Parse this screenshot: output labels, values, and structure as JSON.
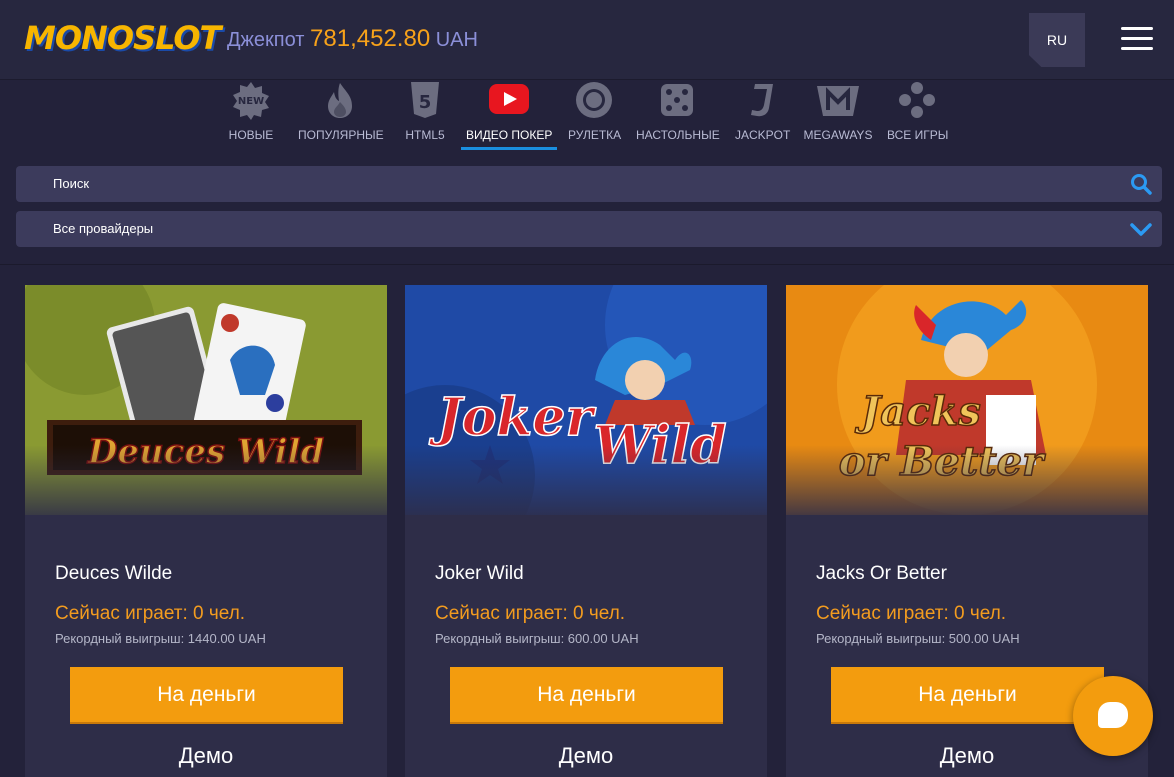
{
  "header": {
    "logo_text": "MONOSLOT",
    "jackpot_label": "Джекпот",
    "jackpot_amount": "781,452.80",
    "jackpot_currency": "UAH",
    "lang": "RU"
  },
  "categories": [
    {
      "label": "НОВЫЕ",
      "icon": "new-badge-icon"
    },
    {
      "label": "ПОПУЛЯРНЫЕ",
      "icon": "fire-icon"
    },
    {
      "label": "HTML5",
      "icon": "html5-icon"
    },
    {
      "label": "ВИДЕО ПОКЕР",
      "icon": "video-play-icon",
      "active": true
    },
    {
      "label": "РУЛЕТКА",
      "icon": "roulette-icon"
    },
    {
      "label": "НАСТОЛЬНЫЕ",
      "icon": "dice-icon"
    },
    {
      "label": "JACKPOT",
      "icon": "jackpot-icon"
    },
    {
      "label": "MEGAWAYS",
      "icon": "megaways-icon"
    },
    {
      "label": "ВСЕ ИГРЫ",
      "icon": "all-games-icon"
    }
  ],
  "search": {
    "placeholder": "Поиск"
  },
  "providers": {
    "selected": "Все провайдеры"
  },
  "games": [
    {
      "title": "Deuces Wilde",
      "players": "Сейчас играет: 0 чел.",
      "record": "Рекордный выигрыш: 1440.00 UAH",
      "money": "На деньги",
      "demo": "Демо",
      "art_text": "Deuces Wild"
    },
    {
      "title": "Joker Wild",
      "players": "Сейчас играет: 0 чел.",
      "record": "Рекордный выигрыш: 600.00 UAH",
      "money": "На деньги",
      "demo": "Демо",
      "art_text": "Joker Wild"
    },
    {
      "title": "Jacks Or Better",
      "players": "Сейчас играет: 0 чел.",
      "record": "Рекордный выигрыш: 500.00 UAH",
      "money": "На деньги",
      "demo": "Демо",
      "art_text": "Jacks or Better"
    }
  ],
  "colors": {
    "accent": "#f39c0e",
    "active_underline": "#1a8fe0",
    "jackpot": "#f7a21a"
  }
}
